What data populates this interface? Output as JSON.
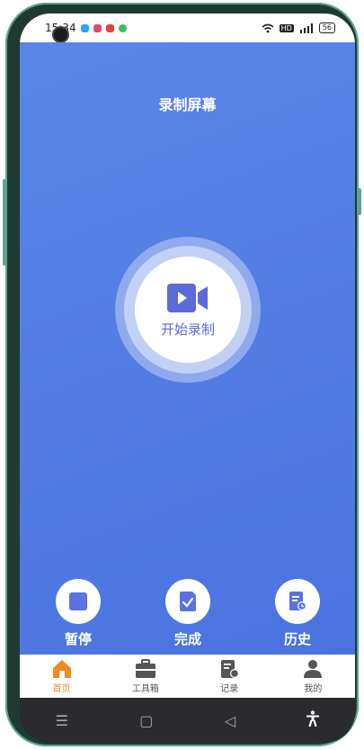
{
  "status_bar": {
    "time": "15:34",
    "right_text": "HD",
    "battery": "56"
  },
  "page": {
    "title": "录制屏幕"
  },
  "record": {
    "label": "开始录制",
    "accent": "#5b6ad6"
  },
  "actions": [
    {
      "label": "暂停",
      "icon": "pause-icon"
    },
    {
      "label": "完成",
      "icon": "done-icon"
    },
    {
      "label": "历史",
      "icon": "history-icon"
    }
  ],
  "tabs": [
    {
      "label": "首页",
      "icon": "home-icon",
      "active": true
    },
    {
      "label": "工具箱",
      "icon": "toolbox-icon",
      "active": false
    },
    {
      "label": "记录",
      "icon": "record-icon",
      "active": false
    },
    {
      "label": "我的",
      "icon": "profile-icon",
      "active": false
    }
  ],
  "colors": {
    "main_bg": "#4f79e2",
    "tab_active": "#f08a24"
  }
}
